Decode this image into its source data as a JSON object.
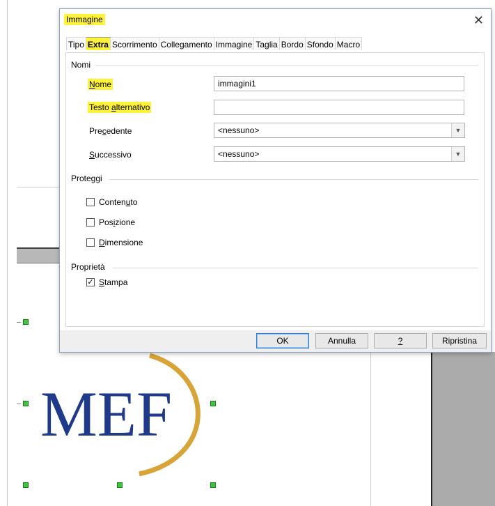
{
  "dialog": {
    "title": "Immagine",
    "close_glyph": "✕",
    "tabs": [
      "Tipo",
      "Extra",
      "Scorrimento",
      "Collegamento",
      "Immagine",
      "Taglia",
      "Bordo",
      "Sfondo",
      "Macro"
    ],
    "active_tab": "Extra"
  },
  "names": {
    "section": "Nomi",
    "name_label_u": "N",
    "name_label_rest": "ome",
    "name_value": "immagini1",
    "alt_label_pre": "Testo ",
    "alt_label_u": "a",
    "alt_label_rest": "lternativo",
    "alt_value": "",
    "prev_label_pre": "Pre",
    "prev_label_u": "c",
    "prev_label_rest": "edente",
    "prev_value": "<nessuno>",
    "next_label_u": "S",
    "next_label_rest": "uccessivo",
    "next_value": "<nessuno>"
  },
  "protect": {
    "section": "Proteggi",
    "content_pre": "Conten",
    "content_u": "u",
    "content_rest": "to",
    "position_pre": "Pos",
    "position_u": "i",
    "position_rest": "zione",
    "size_u": "D",
    "size_rest": "imensione"
  },
  "props": {
    "section": "Proprietà",
    "print_u": "S",
    "print_rest": "tampa",
    "print_checked": true
  },
  "buttons": {
    "ok": "OK",
    "cancel": "Annulla",
    "help": "?",
    "reset": "Ripristina"
  },
  "background": {
    "logo_text": "MEF",
    "logo_color": "#1f3a8a",
    "ring_color": "#d9a437"
  },
  "colors": {
    "highlight": "#fff23a",
    "handle": "#3fc53f"
  }
}
